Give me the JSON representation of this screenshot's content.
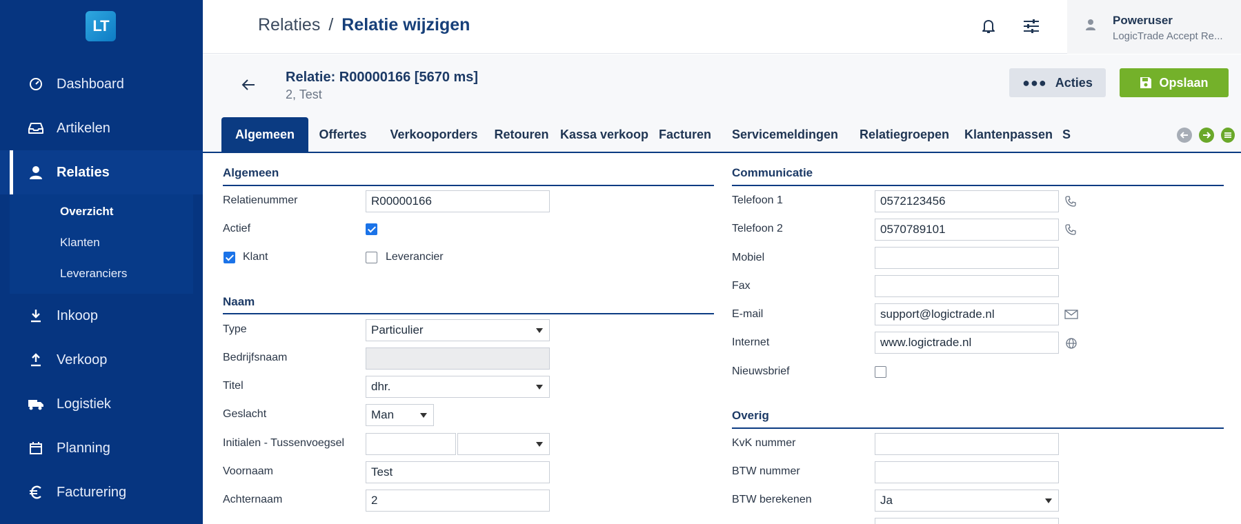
{
  "logo": {
    "text": "LT"
  },
  "sidebar": {
    "items": [
      {
        "label": "Dashboard",
        "icon": "dashboard-icon"
      },
      {
        "label": "Artikelen",
        "icon": "inbox-icon"
      },
      {
        "label": "Relaties",
        "icon": "user-icon"
      },
      {
        "label": "Inkoop",
        "icon": "download-icon"
      },
      {
        "label": "Verkoop",
        "icon": "upload-icon"
      },
      {
        "label": "Logistiek",
        "icon": "truck-icon"
      },
      {
        "label": "Planning",
        "icon": "calendar-icon"
      },
      {
        "label": "Facturering",
        "icon": "euro-icon"
      }
    ],
    "subitems": [
      {
        "label": "Overzicht"
      },
      {
        "label": "Klanten"
      },
      {
        "label": "Leveranciers"
      }
    ]
  },
  "header": {
    "crumb_parent": "Relaties",
    "crumb_sep": "/",
    "crumb_current": "Relatie wijzigen",
    "user_name": "Poweruser",
    "user_org": "LogicTrade Accept Re..."
  },
  "subheader": {
    "title": "Relatie: R00000166 [5670 ms]",
    "subtitle": "2, Test",
    "acties_label": "Acties",
    "save_label": "Opslaan"
  },
  "tabs": [
    {
      "label": "Algemeen"
    },
    {
      "label": "Offertes"
    },
    {
      "label": "Verkooporders"
    },
    {
      "label": "Retouren"
    },
    {
      "label": "Kassa verkoop"
    },
    {
      "label": "Facturen"
    },
    {
      "label": "Servicemeldingen"
    },
    {
      "label": "Relatiegroepen"
    },
    {
      "label": "Klantenpassen"
    },
    {
      "label": "S"
    }
  ],
  "algemeen": {
    "heading": "Algemeen",
    "relatienummer_label": "Relatienummer",
    "relatienummer_value": "R00000166",
    "actief_label": "Actief",
    "klant_label": "Klant",
    "leverancier_label": "Leverancier"
  },
  "naam": {
    "heading": "Naam",
    "type_label": "Type",
    "type_value": "Particulier",
    "bedrijfsnaam_label": "Bedrijfsnaam",
    "titel_label": "Titel",
    "titel_value": "dhr.",
    "geslacht_label": "Geslacht",
    "geslacht_value": "Man",
    "initialen_label": "Initialen - Tussenvoegsel",
    "voornaam_label": "Voornaam",
    "voornaam_value": "Test",
    "achternaam_label": "Achternaam",
    "achternaam_value": "2"
  },
  "communicatie": {
    "heading": "Communicatie",
    "tel1_label": "Telefoon 1",
    "tel1_value": "0572123456",
    "tel2_label": "Telefoon 2",
    "tel2_value": "0570789101",
    "mobiel_label": "Mobiel",
    "fax_label": "Fax",
    "email_label": "E-mail",
    "email_value": "support@logictrade.nl",
    "internet_label": "Internet",
    "internet_value": "www.logictrade.nl",
    "nieuwsbrief_label": "Nieuwsbrief"
  },
  "overig": {
    "heading": "Overig",
    "kvk_label": "KvK nummer",
    "btw_label": "BTW nummer",
    "btw_ber_label": "BTW berekenen",
    "btw_ber_value": "Ja"
  },
  "colors": {
    "sidebar": "#063580",
    "accent": "#0b3b82",
    "save": "#74b12a"
  }
}
